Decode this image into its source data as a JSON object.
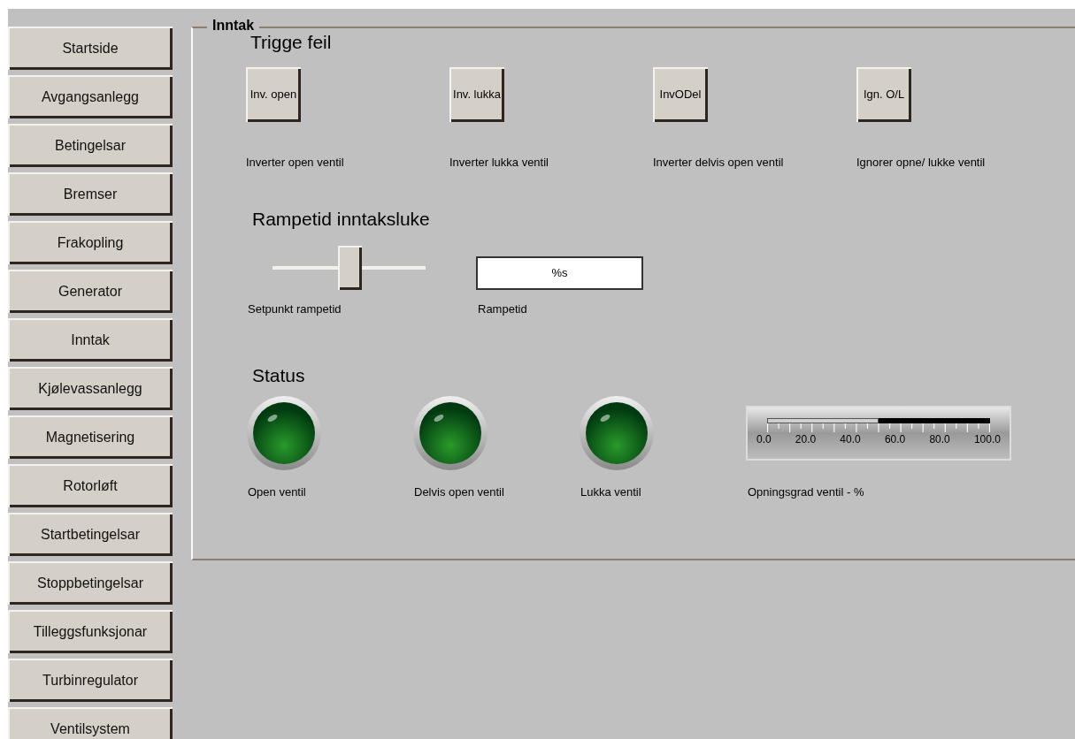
{
  "nav": [
    {
      "label": "Startside",
      "selected": false
    },
    {
      "label": "Avgangsanlegg",
      "selected": false
    },
    {
      "label": "Betingelsar",
      "selected": false
    },
    {
      "label": "Bremser",
      "selected": false
    },
    {
      "label": "Frakopling",
      "selected": false
    },
    {
      "label": "Generator",
      "selected": false
    },
    {
      "label": "Inntak",
      "selected": false
    },
    {
      "label": "Kjølevassanlegg",
      "selected": false
    },
    {
      "label": "Magnetisering",
      "selected": false
    },
    {
      "label": "Rotorløft",
      "selected": false
    },
    {
      "label": "Startbetingelsar",
      "selected": false
    },
    {
      "label": "Stoppbetingelsar",
      "selected": false
    },
    {
      "label": "Tilleggsfunksjonar",
      "selected": false
    },
    {
      "label": "Turbinregulator",
      "selected": false
    },
    {
      "label": "Ventilsystem",
      "selected": false
    }
  ],
  "group": {
    "title": "Inntak"
  },
  "faults": {
    "heading": "Trigge feil",
    "buttons": [
      {
        "label": "Inv. open",
        "caption": "Inverter open ventil"
      },
      {
        "label": "Inv. lukka",
        "caption": "Inverter lukka ventil"
      },
      {
        "label": "InvODel",
        "caption": "Inverter delvis open ventil"
      },
      {
        "label": "Ign. O/L",
        "caption": "Ignorer opne/ lukke ventil"
      }
    ]
  },
  "ramp": {
    "heading": "Rampetid inntaksluke",
    "slider": {
      "level": 0.5,
      "caption": "Setpunkt rampetid"
    },
    "field": {
      "value": "%s",
      "caption": "Rampetid"
    }
  },
  "status": {
    "heading": "Status",
    "lamps": [
      {
        "caption": "Open ventil",
        "on": false
      },
      {
        "caption": "Delvis open ventil",
        "on": false
      },
      {
        "caption": "Lukka ventil",
        "on": false
      }
    ],
    "gauge": {
      "level": 0.5,
      "scale": [
        "0.0",
        "20.0",
        "40.0",
        "60.0",
        "80.0",
        "100.0"
      ],
      "caption": "Opningsgrad ventil - %"
    }
  }
}
